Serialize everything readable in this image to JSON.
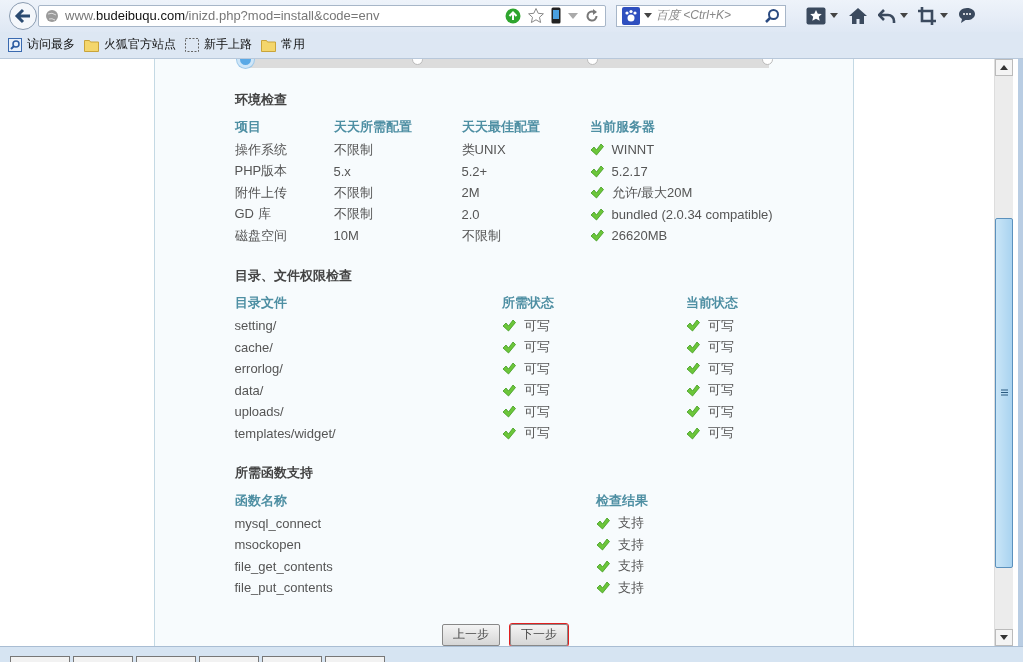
{
  "browser": {
    "url": "www.**budeibuqu.com**/inizd.php?mod=install&code=env",
    "search_placeholder": "百度 <Ctrl+K>"
  },
  "bookmarks": [
    {
      "label": "访问最多",
      "kind": "smart"
    },
    {
      "label": "火狐官方站点",
      "kind": "folder"
    },
    {
      "label": "新手上路",
      "kind": "page"
    },
    {
      "label": "常用",
      "kind": "folder"
    }
  ],
  "steps": [
    {
      "selected": true
    },
    {
      "selected": false
    },
    {
      "selected": false
    },
    {
      "selected": false
    }
  ],
  "sections": [
    {
      "title": "环境检查",
      "columns": [
        "项目",
        "天天所需配置",
        "天天最佳配置",
        "当前服务器"
      ],
      "rows": [
        {
          "cells": [
            {
              "text": "操作系统"
            },
            {
              "text": "不限制"
            },
            {
              "text": "类UNIX"
            },
            {
              "text": "WINNT",
              "ok": true
            }
          ]
        },
        {
          "cells": [
            {
              "text": "PHP版本"
            },
            {
              "text": "5.x"
            },
            {
              "text": "5.2+"
            },
            {
              "text": "5.2.17",
              "ok": true
            }
          ]
        },
        {
          "cells": [
            {
              "text": "附件上传"
            },
            {
              "text": "不限制"
            },
            {
              "text": "2M"
            },
            {
              "text": "允许/最大20M",
              "ok": true
            }
          ]
        },
        {
          "cells": [
            {
              "text": "GD 库"
            },
            {
              "text": "不限制"
            },
            {
              "text": "2.0"
            },
            {
              "text": "bundled (2.0.34 compatible)",
              "ok": true
            }
          ]
        },
        {
          "cells": [
            {
              "text": "磁盘空间"
            },
            {
              "text": "10M"
            },
            {
              "text": "不限制"
            },
            {
              "text": "26620MB",
              "ok": true
            }
          ]
        }
      ]
    },
    {
      "title": "目录、文件权限检查",
      "columns": [
        "目录文件",
        "所需状态",
        "当前状态"
      ],
      "rows": [
        {
          "cells": [
            {
              "text": "setting/"
            },
            {
              "text": "可写",
              "ok": true
            },
            {
              "text": "可写",
              "ok": true
            }
          ]
        },
        {
          "cells": [
            {
              "text": "cache/"
            },
            {
              "text": "可写",
              "ok": true
            },
            {
              "text": "可写",
              "ok": true
            }
          ]
        },
        {
          "cells": [
            {
              "text": "errorlog/"
            },
            {
              "text": "可写",
              "ok": true
            },
            {
              "text": "可写",
              "ok": true
            }
          ]
        },
        {
          "cells": [
            {
              "text": "data/"
            },
            {
              "text": "可写",
              "ok": true
            },
            {
              "text": "可写",
              "ok": true
            }
          ]
        },
        {
          "cells": [
            {
              "text": "uploads/"
            },
            {
              "text": "可写",
              "ok": true
            },
            {
              "text": "可写",
              "ok": true
            }
          ]
        },
        {
          "cells": [
            {
              "text": "templates/widget/"
            },
            {
              "text": "可写",
              "ok": true
            },
            {
              "text": "可写",
              "ok": true
            }
          ]
        }
      ]
    },
    {
      "title": "所需函数支持",
      "columns": [
        "函数名称",
        "检查结果"
      ],
      "rows": [
        {
          "cells": [
            {
              "text": "mysql_connect"
            },
            {
              "text": "支持",
              "ok": true
            }
          ]
        },
        {
          "cells": [
            {
              "text": "msockopen"
            },
            {
              "text": "支持",
              "ok": true
            }
          ]
        },
        {
          "cells": [
            {
              "text": "file_get_contents"
            },
            {
              "text": "支持",
              "ok": true
            }
          ]
        },
        {
          "cells": [
            {
              "text": "file_put_contents"
            },
            {
              "text": "支持",
              "ok": true
            }
          ]
        }
      ]
    }
  ],
  "buttons": [
    {
      "label": "上一步",
      "highlighted": false
    },
    {
      "label": "下一步",
      "highlighted": true
    }
  ]
}
